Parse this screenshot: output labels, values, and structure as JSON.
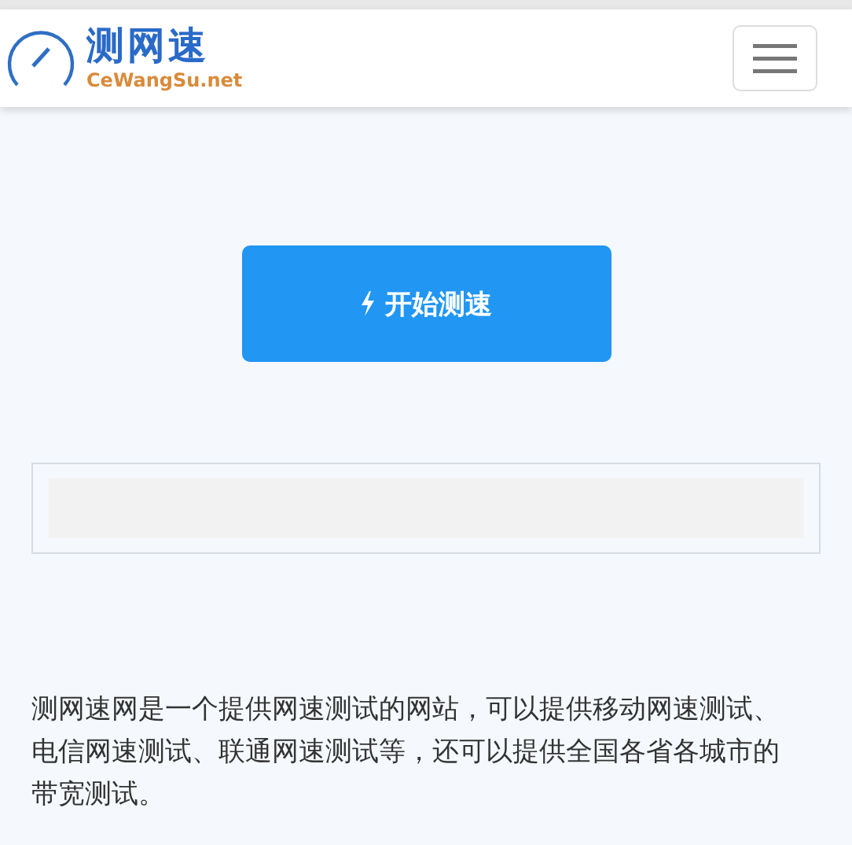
{
  "header": {
    "logo_title": "测网速",
    "logo_subtitle": "CeWangSu.net"
  },
  "start_button": {
    "label": "开始测速"
  },
  "result_panel": {
    "level": 0
  },
  "description": "测网速网是一个提供网速测试的网站，可以提供移动网速测试、电信网速测试、联通网速测试等，还可以提供全国各省各城市的带宽测试。"
}
